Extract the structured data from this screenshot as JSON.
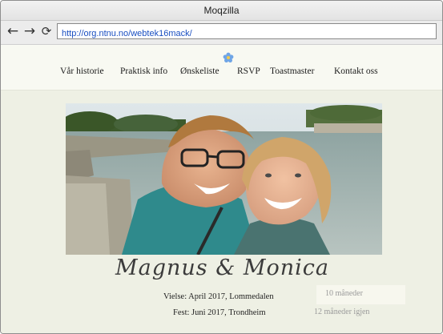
{
  "window": {
    "title": "Moqzilla"
  },
  "toolbar": {
    "back_icon": "back-arrow-icon",
    "forward_icon": "forward-arrow-icon",
    "reload_icon": "reload-icon",
    "url": "http://org.ntnu.no/webtek16mack/"
  },
  "site": {
    "nav": [
      {
        "label": "Vår historie"
      },
      {
        "label": "Praktisk info"
      },
      {
        "label": "Ønskeliste"
      },
      {
        "label": "RSVP"
      },
      {
        "label": "Toastmaster"
      },
      {
        "label": "Kontakt oss"
      }
    ],
    "logo_icon": "flower-icon",
    "couple_title": "Magnus & Monica",
    "engagement": "Vielse: April 2017, Lommedalen",
    "party": "Fest: Juni 2017, Trondheim",
    "countdown_engagement": "10 måneder",
    "countdown_party": "12 måneder igjen",
    "colors": {
      "page_bg": "#eef0e4",
      "nav_bg": "#f8f9f2",
      "link": "#1a4fc1"
    }
  }
}
